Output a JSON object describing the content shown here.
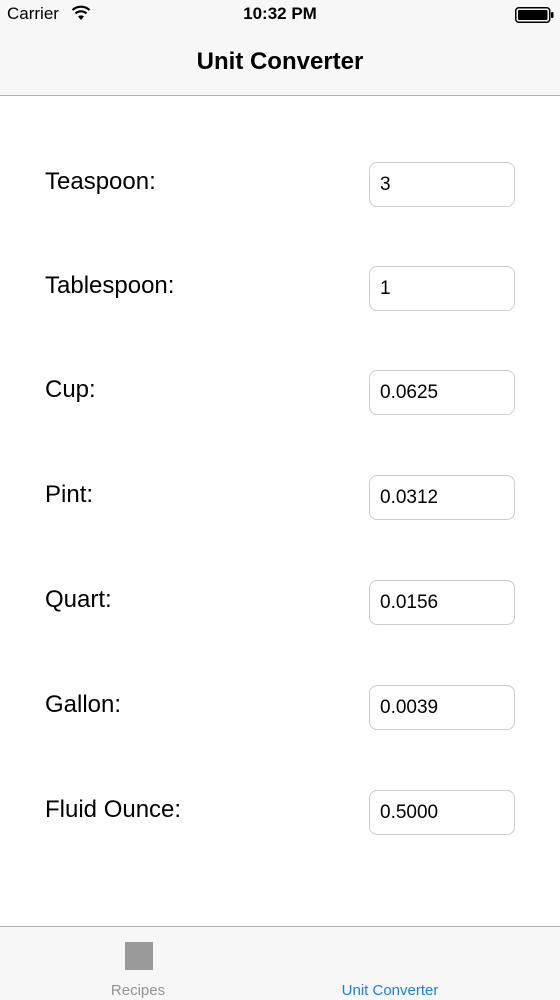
{
  "status_bar": {
    "carrier": "Carrier",
    "time": "10:32 PM"
  },
  "nav": {
    "title": "Unit Converter"
  },
  "units": [
    {
      "label": "Teaspoon:",
      "value": "3"
    },
    {
      "label": "Tablespoon:",
      "value": "1"
    },
    {
      "label": "Cup:",
      "value": "0.0625"
    },
    {
      "label": "Pint:",
      "value": "0.0312"
    },
    {
      "label": "Quart:",
      "value": "0.0156"
    },
    {
      "label": "Gallon:",
      "value": "0.0039"
    },
    {
      "label": "Fluid Ounce:",
      "value": "0.5000"
    }
  ],
  "tab_bar": {
    "tabs": [
      {
        "label": "Recipes",
        "selected": false
      },
      {
        "label": "Unit Converter",
        "selected": true
      }
    ],
    "selected_color": "#1a7cf5",
    "unselected_color": "#929292"
  }
}
